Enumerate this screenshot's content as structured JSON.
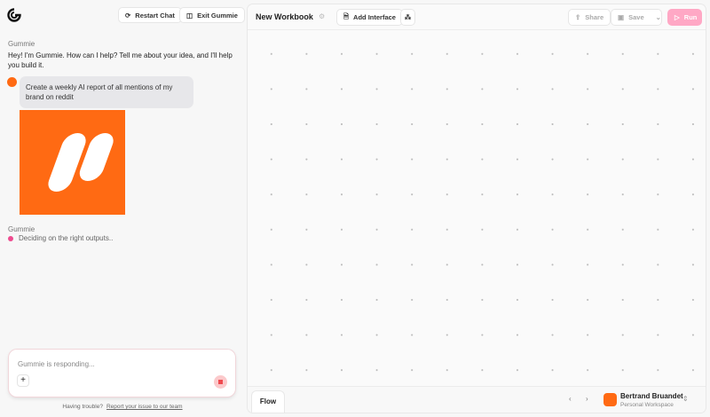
{
  "chat": {
    "restart_label": "Restart Chat",
    "exit_label": "Exit Gummie",
    "assistant_name": "Gummie",
    "greeting": "Hey! I'm Gummie. How can I help? Tell me about your idea, and I'll help you build it.",
    "user_message": "Create a weekly AI report of all mentions of my brand on reddit",
    "assistant_name_2": "Gummie",
    "status": "Deciding on the right outputs..",
    "input_placeholder": "Gummie is responding...",
    "help_text": "Having trouble?",
    "help_link": "Report your issue to our team"
  },
  "workbook": {
    "title": "New Workbook",
    "add_interface": "Add Interface",
    "share": "Share",
    "save": "Save",
    "run": "Run",
    "tab": "Flow",
    "user_name": "Bertrand Bruandet",
    "workspace": "Personal Workspace"
  },
  "colors": {
    "brand": "#ff6a13",
    "run": "#ffa8c5",
    "status_dot": "#ee4b8f"
  }
}
